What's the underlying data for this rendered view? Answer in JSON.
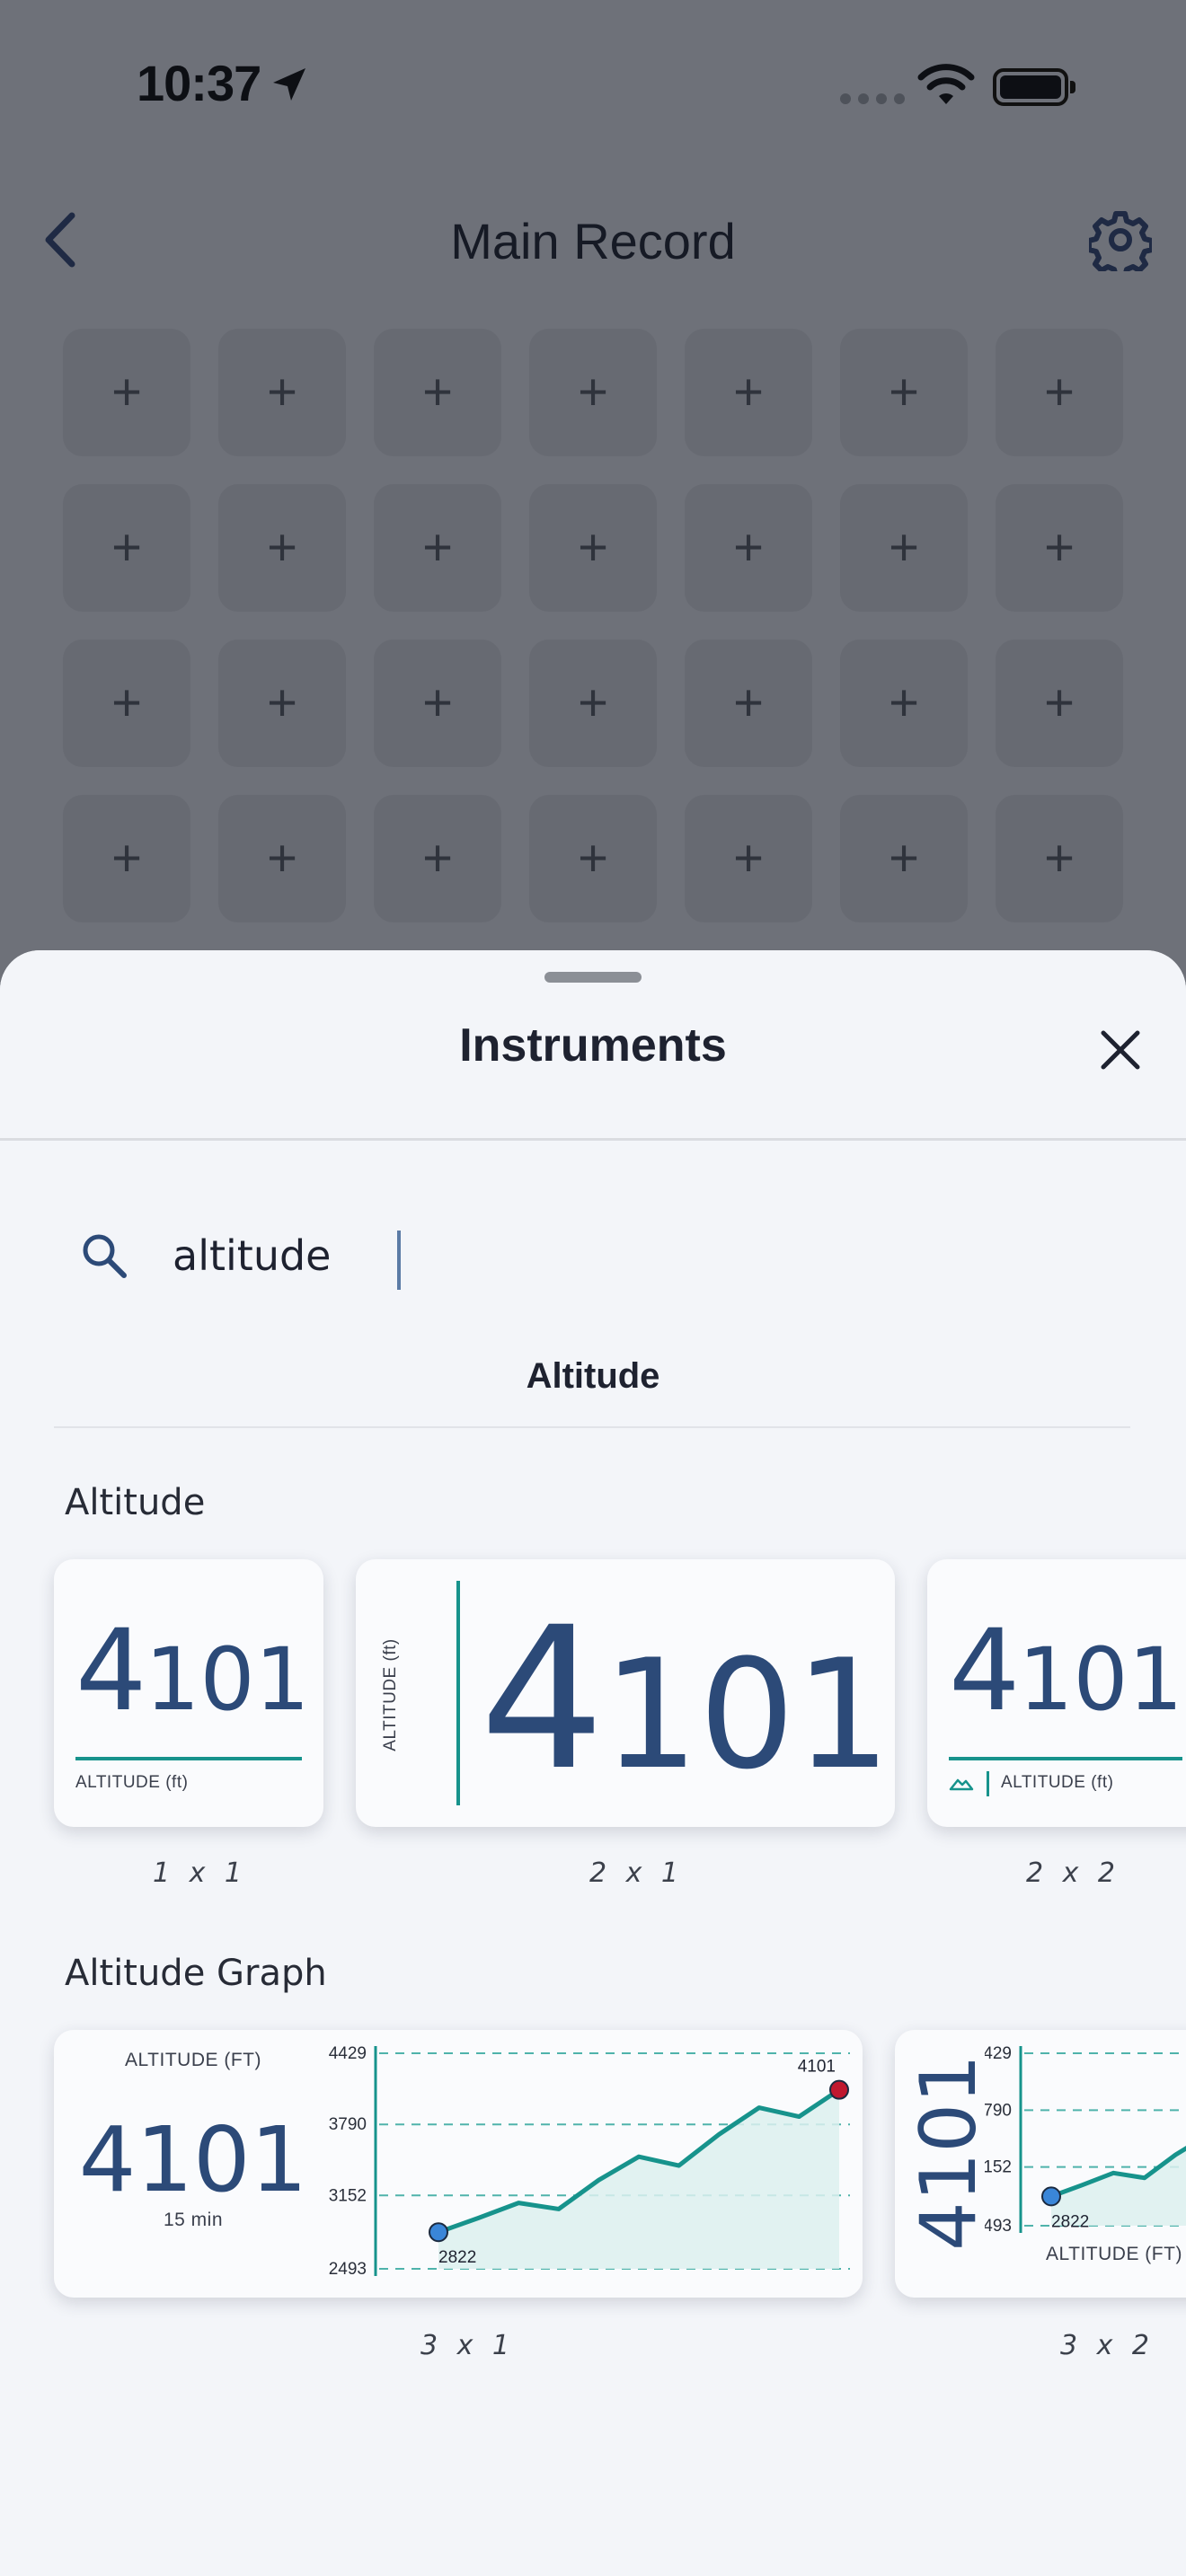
{
  "status_bar": {
    "time": "10:37"
  },
  "nav": {
    "title": "Main Record"
  },
  "grid": {
    "rows": 4,
    "cols": 7,
    "slot_symbol": "+"
  },
  "sheet": {
    "title": "Instruments",
    "search": {
      "value": "altitude",
      "placeholder": ""
    },
    "filter_label": "Altitude",
    "sections": [
      {
        "title": "Altitude",
        "cards": [
          {
            "value_lead": "4",
            "value_rest": "101",
            "label": "ALTITUDE (ft)",
            "size": "1 x 1"
          },
          {
            "value_lead": "4",
            "value_rest": "101",
            "label": "ALTITUDE (ft)",
            "size": "2 x 1"
          },
          {
            "value_lead": "4",
            "value_rest": "101",
            "label": "ALTITUDE (ft)",
            "size": "2 x 2"
          }
        ]
      },
      {
        "title": "Altitude Graph",
        "cards": [
          {
            "label": "ALTITUDE (FT)",
            "value": "4101",
            "period": "15 min",
            "size": "3 x 1"
          },
          {
            "label": "ALTITUDE (FT)",
            "value": "4101",
            "size": "3 x 2"
          }
        ]
      }
    ]
  },
  "chart_data": {
    "type": "area",
    "title": "ALTITUDE (FT)",
    "x": [
      0,
      1,
      2,
      3,
      4,
      5,
      6,
      7,
      8,
      9,
      10
    ],
    "y": [
      2822,
      2950,
      3085,
      3030,
      3290,
      3500,
      3420,
      3700,
      3940,
      3860,
      4101
    ],
    "yticks": [
      2493,
      3152,
      3790,
      4429
    ],
    "ylim": [
      2493,
      4429
    ],
    "start_label": "2822",
    "end_label": "4101",
    "grid": true,
    "colors": {
      "line": "#17938c",
      "fill": "#dcf0ef",
      "start_point": "#3a86d8",
      "end_point": "#c0182f"
    }
  }
}
